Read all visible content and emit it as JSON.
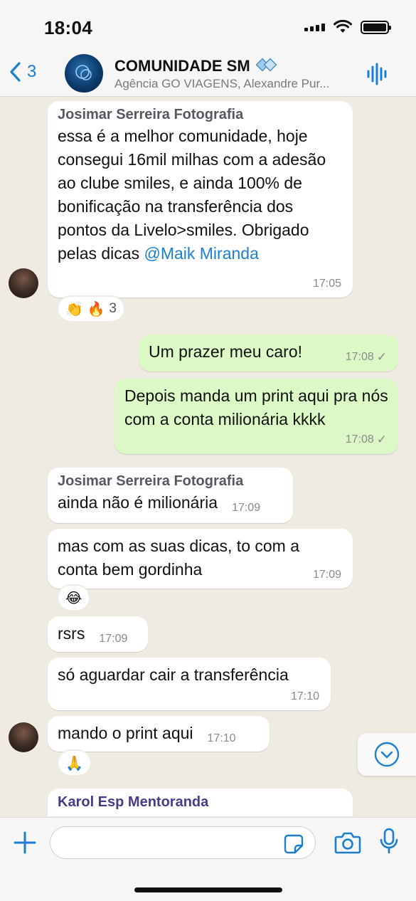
{
  "status_bar": {
    "time": "18:04"
  },
  "header": {
    "back_count": "3",
    "group_name": "COMUNIDADE SM",
    "members": "Agência GO VIAGENS, Alexandre Pur..."
  },
  "messages": [
    {
      "sender": "Josimar Serreira Fotografia",
      "text": "essa é a melhor comunidade, hoje consegui 16mil milhas com a adesão ao clube smiles, e ainda 100% de bonificação na transferência dos pontos da Livelo>smiles. Obrigado pelas dicas ",
      "mention": "@Maik Miranda",
      "time": "17:05",
      "reaction_emojis": "👏 🔥",
      "reaction_count": "3"
    },
    {
      "text": "Um prazer meu caro!",
      "time": "17:08",
      "check": "✓"
    },
    {
      "text": "Depois manda um print aqui pra nós com a conta milionária kkkk",
      "time": "17:08",
      "check": "✓"
    },
    {
      "sender": "Josimar Serreira Fotografia",
      "text": "ainda não é milionária",
      "time": "17:09"
    },
    {
      "text": "mas com as suas dicas, to com a conta bem gordinha",
      "time": "17:09",
      "reaction_emojis": "😂"
    },
    {
      "text": "rsrs",
      "time": "17:09"
    },
    {
      "text": "só aguardar cair a transferência",
      "time": "17:10"
    },
    {
      "text": "mando o print aqui",
      "time": "17:10",
      "reaction_emojis": "🙏"
    },
    {
      "sender": "Karol Esp Mentoranda"
    }
  ],
  "icons": {
    "back": "chevron-left-icon",
    "verified": "community-badge-icon",
    "audio": "audio-wave-icon",
    "scroll": "chevron-down-icon",
    "plus": "plus-icon",
    "sticker": "sticker-icon",
    "camera": "camera-icon",
    "mic": "microphone-icon"
  },
  "colors": {
    "accent": "#1b7fd1",
    "outgoing": "#dcf8c6",
    "background": "#efeae2"
  }
}
